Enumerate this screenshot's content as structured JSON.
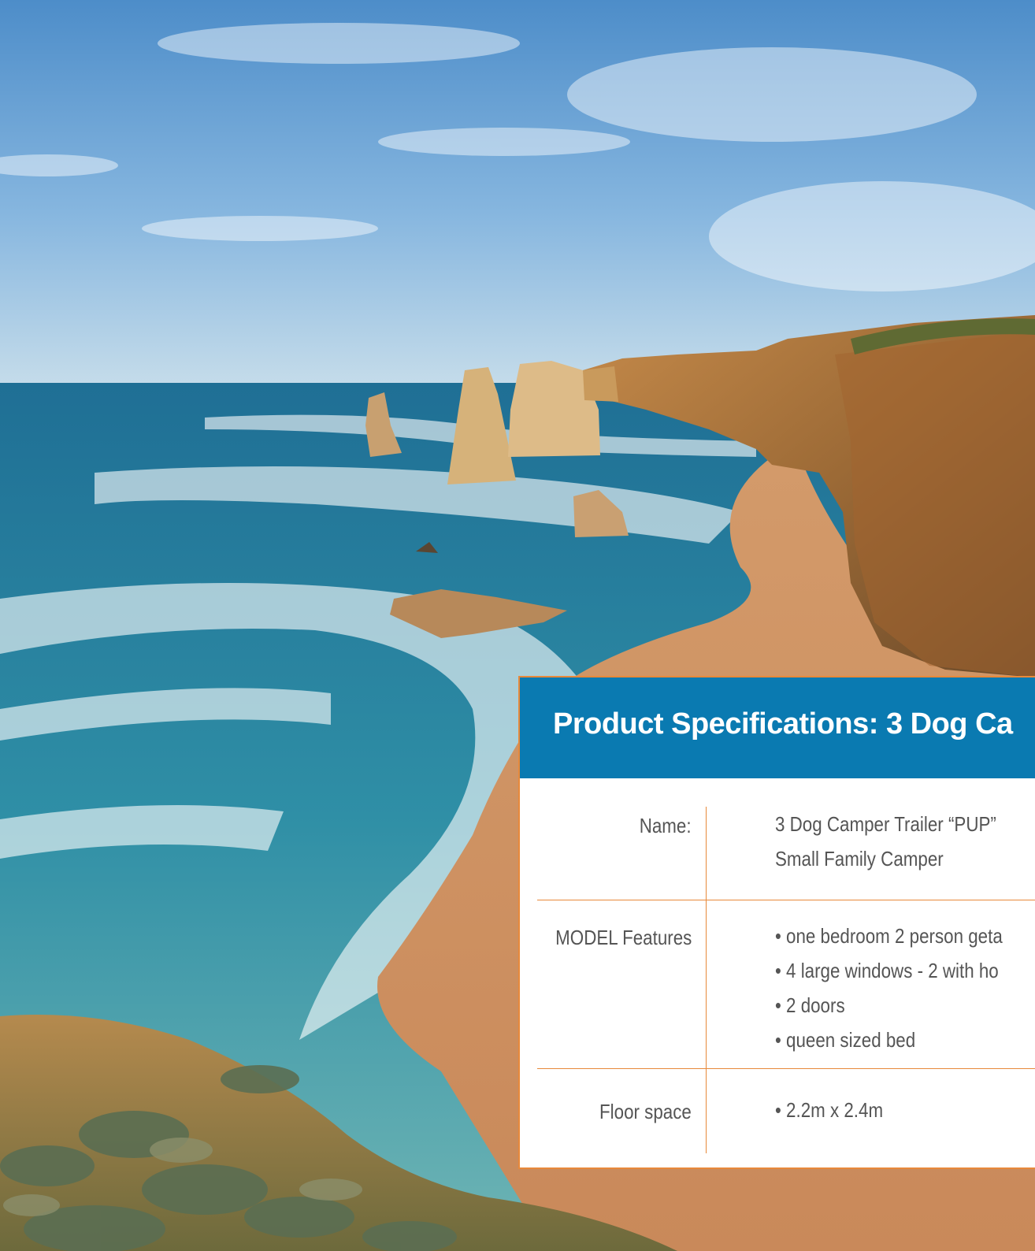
{
  "spec_panel": {
    "title": "Product Specifications: 3 Dog Ca",
    "rows": [
      {
        "label": "Name:",
        "lines": [
          "3 Dog Camper Trailer “PUP”",
          "Small Family Camper"
        ]
      },
      {
        "label": "MODEL Features",
        "lines": [
          "• one bedroom 2 person geta",
          "• 4 large windows - 2 with ho",
          "• 2 doors",
          "• queen sized bed"
        ]
      },
      {
        "label": "Floor space",
        "lines": [
          "• 2.2m x 2.4m"
        ]
      }
    ]
  },
  "colors": {
    "header_blue": "#0a7ab1",
    "accent_orange": "#e8893a",
    "text_gray": "#555555"
  }
}
